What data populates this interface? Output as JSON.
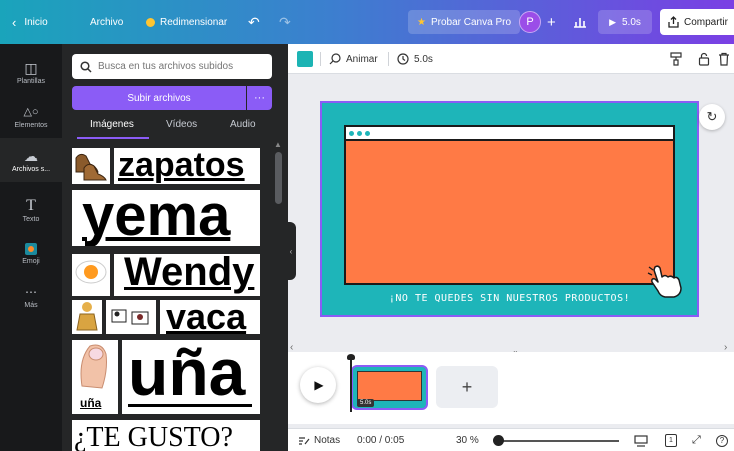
{
  "topbar": {
    "back_label": "Inicio",
    "file_label": "Archivo",
    "resize_label": "Redimensionar",
    "pro_label": "Probar Canva Pro",
    "avatar_letter": "P",
    "duration_label": "5.0s",
    "share_label": "Compartir"
  },
  "rail": {
    "items": [
      {
        "label": "Plantillas",
        "icon": "layout-icon"
      },
      {
        "label": "Elementos",
        "icon": "shapes-icon"
      },
      {
        "label": "Archivos s...",
        "icon": "cloud-upload-icon"
      },
      {
        "label": "Texto",
        "icon": "text-icon"
      },
      {
        "label": "Emoji",
        "icon": "emoji-icon"
      },
      {
        "label": "Más",
        "icon": "more-icon"
      }
    ]
  },
  "panel": {
    "search_placeholder": "Busca en tus archivos subidos",
    "upload_label": "Subir archivos",
    "more_label": "···",
    "tabs": [
      "Imágenes",
      "Vídeos",
      "Audio"
    ],
    "thumbs": {
      "zapatos": "zapatos",
      "yema": "yema",
      "wendy": "Wendy",
      "vaca": "vaca",
      "una_big": "uña",
      "una_small": "uña",
      "gusto": "¿TE GUSTO?"
    }
  },
  "editor": {
    "swatch_color": "#1cb4b4",
    "animate_label": "Animar",
    "time_label": "5.0s"
  },
  "slide": {
    "background": "#1eb5b9",
    "window_color": "#ff7a45",
    "text": "¡NO TE QUEDES SIN NUESTROS PRODUCTOS!"
  },
  "timeline": {
    "clip_badge": "5.0s",
    "add_label": "+"
  },
  "bottombar": {
    "notes_label": "Notas",
    "time_label": "0:00 / 0:05",
    "zoom_label": "30 %",
    "page_number": "1",
    "help_label": "?"
  }
}
